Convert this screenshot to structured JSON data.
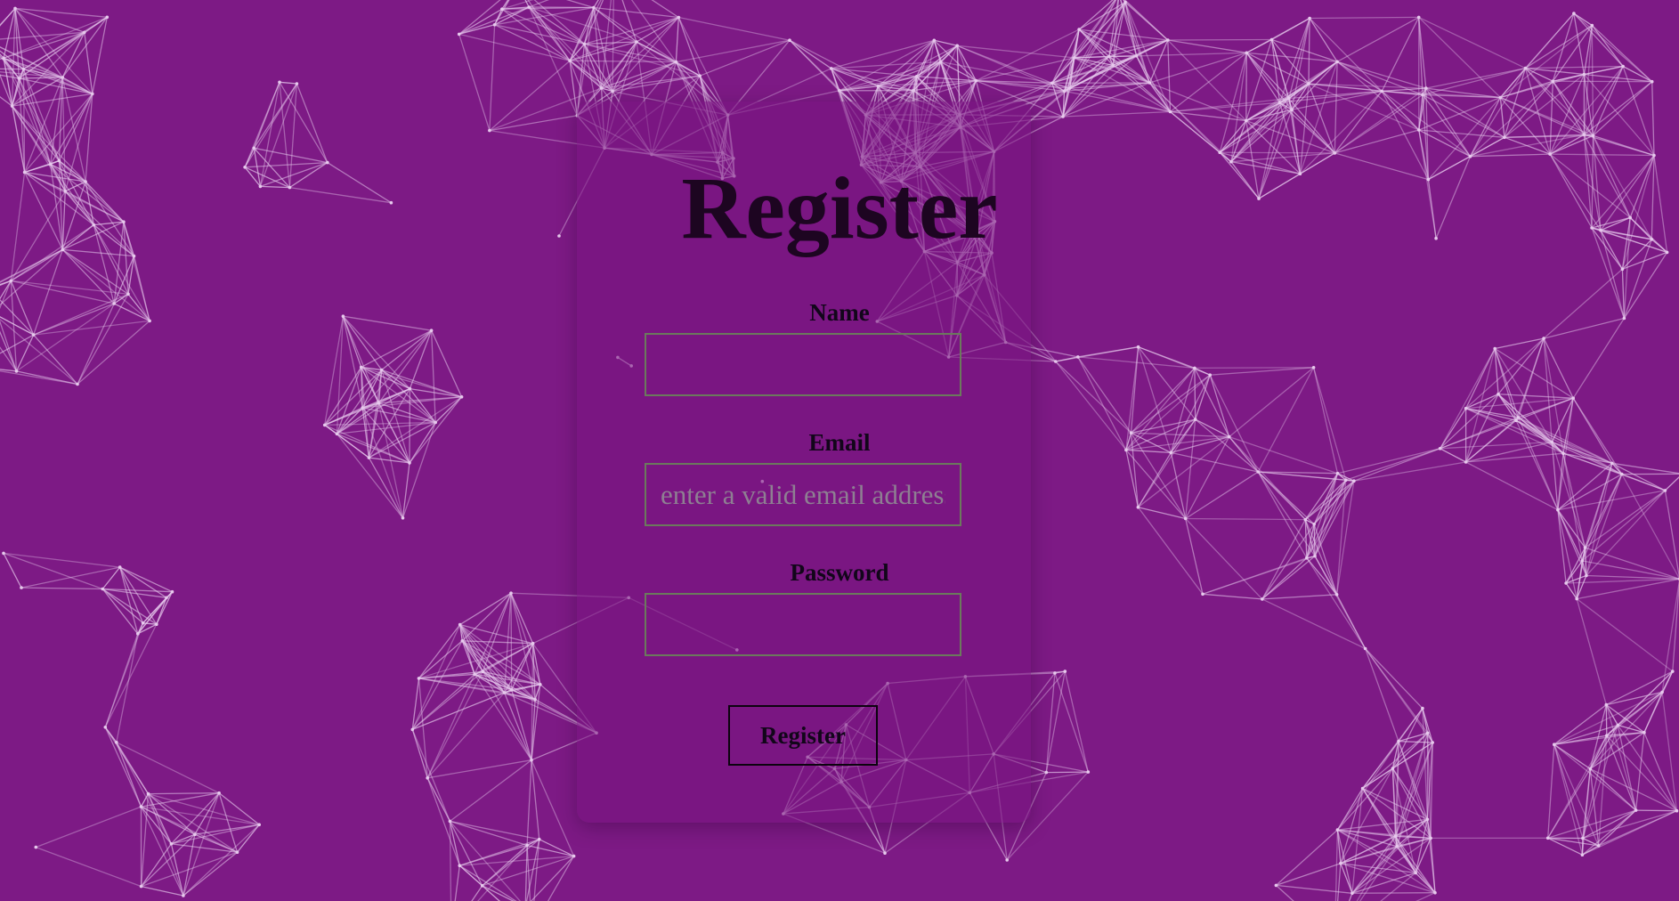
{
  "form": {
    "title": "Register",
    "name_label": "Name",
    "name_value": "",
    "email_label": "Email",
    "email_placeholder": "enter a valid email address",
    "password_label": "Password",
    "password_value": "",
    "submit_label": "Register"
  },
  "colors": {
    "background": "#7d1a85",
    "network_lines": "#e6c9ec",
    "title_text": "#1d0521",
    "input_border": "#6b7a5c",
    "button_border": "#0c030f"
  }
}
